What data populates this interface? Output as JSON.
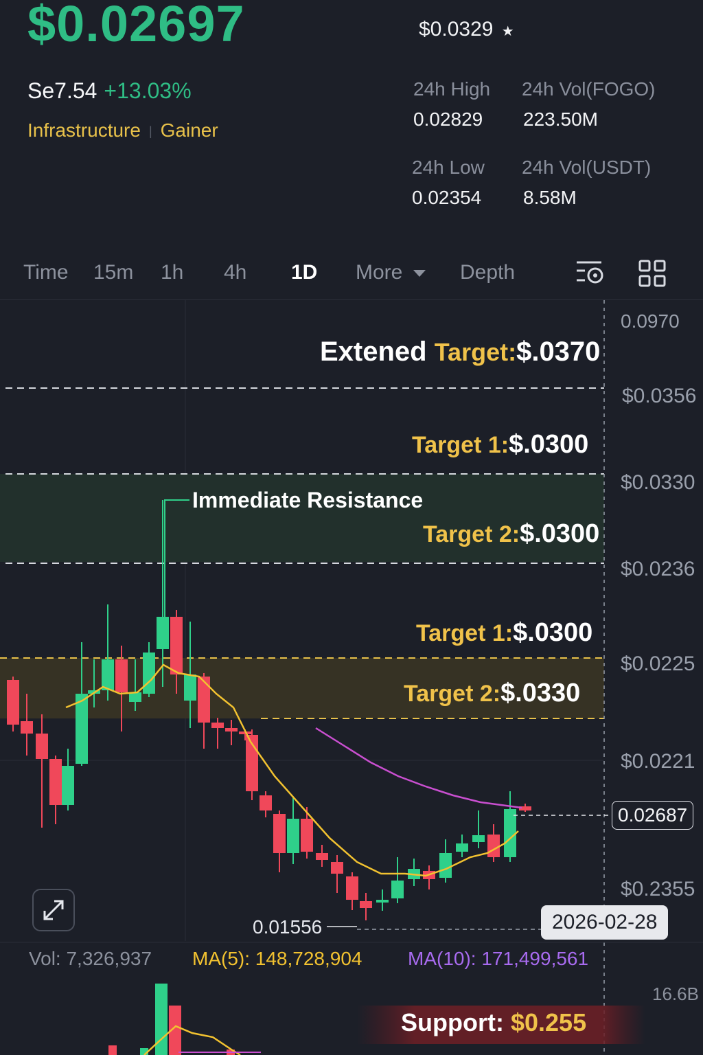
{
  "header": {
    "last_price": "$0.02697",
    "ref_price": "$0.0329",
    "ref_icon": "star-icon",
    "secondary_price": "Se7.54",
    "change_pct": "+13.03%",
    "tags": [
      "Infrastructure",
      "Gainer"
    ]
  },
  "stats": {
    "high_label": "24h High",
    "high_value": "0.02829",
    "vol_fogo_label": "24h Vol(FOGO)",
    "vol_fogo_value": "223.50M",
    "low_label": "24h Low",
    "low_value": "0.02354",
    "vol_usdt_label": "24h Vol(USDT)",
    "vol_usdt_value": "8.58M"
  },
  "tabs": {
    "time": "Time",
    "m15": "15m",
    "h1": "1h",
    "h4": "4h",
    "d1": "1D",
    "more": "More",
    "depth": "Depth",
    "active": "1D"
  },
  "icons": {
    "indicator": "indicator-settings-icon",
    "layout": "grid-layout-icon",
    "expand": "expand-icon",
    "more_caret": "caret-down-icon"
  },
  "price_axis": [
    "0.0970",
    "$0.0356",
    "$0.0330",
    "$0.0236",
    "$0.0225",
    "$0.0221",
    "$0.2355"
  ],
  "annotations": {
    "extended_word": "Extened",
    "extended_target_label": "Target:",
    "extended_target_value": "$.0370",
    "t1_upper_label": "Target 1:",
    "t1_upper_value": "$.0300",
    "immediate_resistance": "Immediate Resistance",
    "t2_upper_label": "Target 2:",
    "t2_upper_value": "$.0300",
    "t1_lower_label": "Target 1:",
    "t1_lower_value": "$.0300",
    "t2_lower_label": "Target 2:",
    "t2_lower_value": "$.0330",
    "low_marker": "0.01556",
    "current_price_tag": "0.02687",
    "date_tag": "2026-02-28",
    "support_label": "Support:",
    "support_value": "$0.255"
  },
  "volume": {
    "vol_label": "Vol: 7,326,937",
    "ma5_label": "MA(5): 148,728,904",
    "ma10_label": "MA(10): 171,499,561",
    "axis_top": "16.6B"
  },
  "colors": {
    "up": "#2fd08a",
    "down": "#f0485a",
    "ma5": "#f2c230",
    "ma10": "#c94fd0",
    "accent_green": "#2fbd85",
    "gold": "#f0c24a"
  }
}
